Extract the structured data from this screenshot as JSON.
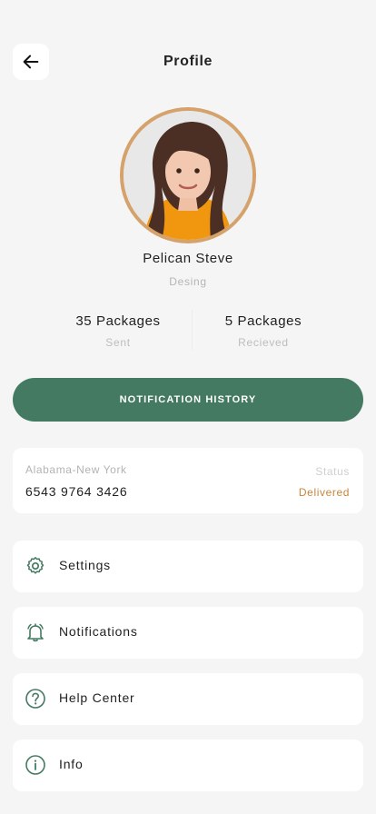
{
  "header": {
    "title": "Profile",
    "back_icon": "arrow-left-icon"
  },
  "profile": {
    "name": "Pelican Steve",
    "role": "Desing",
    "avatar_ring_color": "#d4a26a"
  },
  "stats": [
    {
      "value": "35 Packages",
      "label": "Sent"
    },
    {
      "value": "5 Packages",
      "label": "Recieved"
    }
  ],
  "notification_button": {
    "label": "NOTIFICATION HISTORY",
    "color": "#447a61"
  },
  "shipment": {
    "route": "Alabama-New York",
    "tracking_number": "6543 9764 3426",
    "status_label": "Status",
    "status_value": "Delivered",
    "status_color": "#c7853f"
  },
  "menu": [
    {
      "label": "Settings",
      "icon": "gear-icon"
    },
    {
      "label": "Notifications",
      "icon": "bell-icon"
    },
    {
      "label": "Help Center",
      "icon": "help-icon"
    },
    {
      "label": "Info",
      "icon": "info-icon"
    }
  ]
}
